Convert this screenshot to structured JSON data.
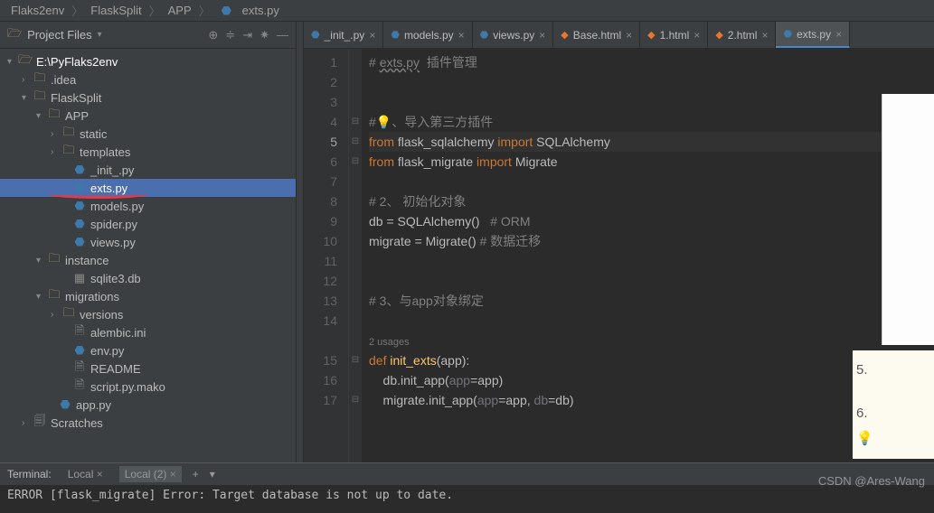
{
  "breadcrumb": {
    "p1": "Flaks2env",
    "p2": "FlaskSplit",
    "p3": "APP",
    "p4": "exts.py"
  },
  "sidebar": {
    "title": "Project Files",
    "tree": {
      "root": "E:\\PyFlaks2env",
      "idea": ".idea",
      "flasksplit": "FlaskSplit",
      "app": "APP",
      "static": "static",
      "templates": "templates",
      "init": "_init_.py",
      "exts": "exts.py",
      "models": "models.py",
      "spider": "spider.py",
      "views": "views.py",
      "instance": "instance",
      "sqlite3": "sqlite3.db",
      "migrations": "migrations",
      "versions": "versions",
      "alembic": "alembic.ini",
      "env": "env.py",
      "readme": "README",
      "script": "script.py.mako",
      "apppy": "app.py",
      "scratches": "Scratches"
    }
  },
  "tabs": {
    "t1": "_init_.py",
    "t2": "models.py",
    "t3": "views.py",
    "t4": "Base.html",
    "t5": "1.html",
    "t6": "2.html",
    "t7": "exts.py"
  },
  "code": {
    "l1a": "# ",
    "l1b": "exts.py",
    "l1c": "  插件管理",
    "l4a": "#",
    "l4b": "💡",
    "l4c": "、导入第三方插件",
    "l5a": "from",
    "l5b": " flask_sqlalchemy ",
    "l5c": "import",
    "l5d": " SQLAlchemy",
    "l6a": "from",
    "l6b": " flask_migrate ",
    "l6c": "import",
    "l6d": " Migrate",
    "l8": "# 2、 初始化对象",
    "l9a": "db = SQLAlchemy()   ",
    "l9b": "# ORM",
    "l10a": "migrate = Migrate() ",
    "l10b": "# 数据迁移",
    "l13": "# 3、与app对象绑定",
    "usages": "2 usages",
    "l15a": "def ",
    "l15b": "init_exts",
    "l15c": "(app):",
    "l16a": "    db.init_app(",
    "l16b": "app",
    "l16c": "=app)",
    "l17a": "    migrate.init_app(",
    "l17b": "app",
    "l17c": "=app",
    "l17d": ", ",
    "l17e": "db",
    "l17f": "=db)"
  },
  "terminal": {
    "label": "Terminal:",
    "tab1": "Local",
    "tab2": "Local (2)",
    "output": "ERROR [flask_migrate] Error: Target database is not up to date."
  },
  "watermark": "CSDN @Ares-Wang",
  "overlay": {
    "n5": "5.",
    "n6": "6."
  }
}
